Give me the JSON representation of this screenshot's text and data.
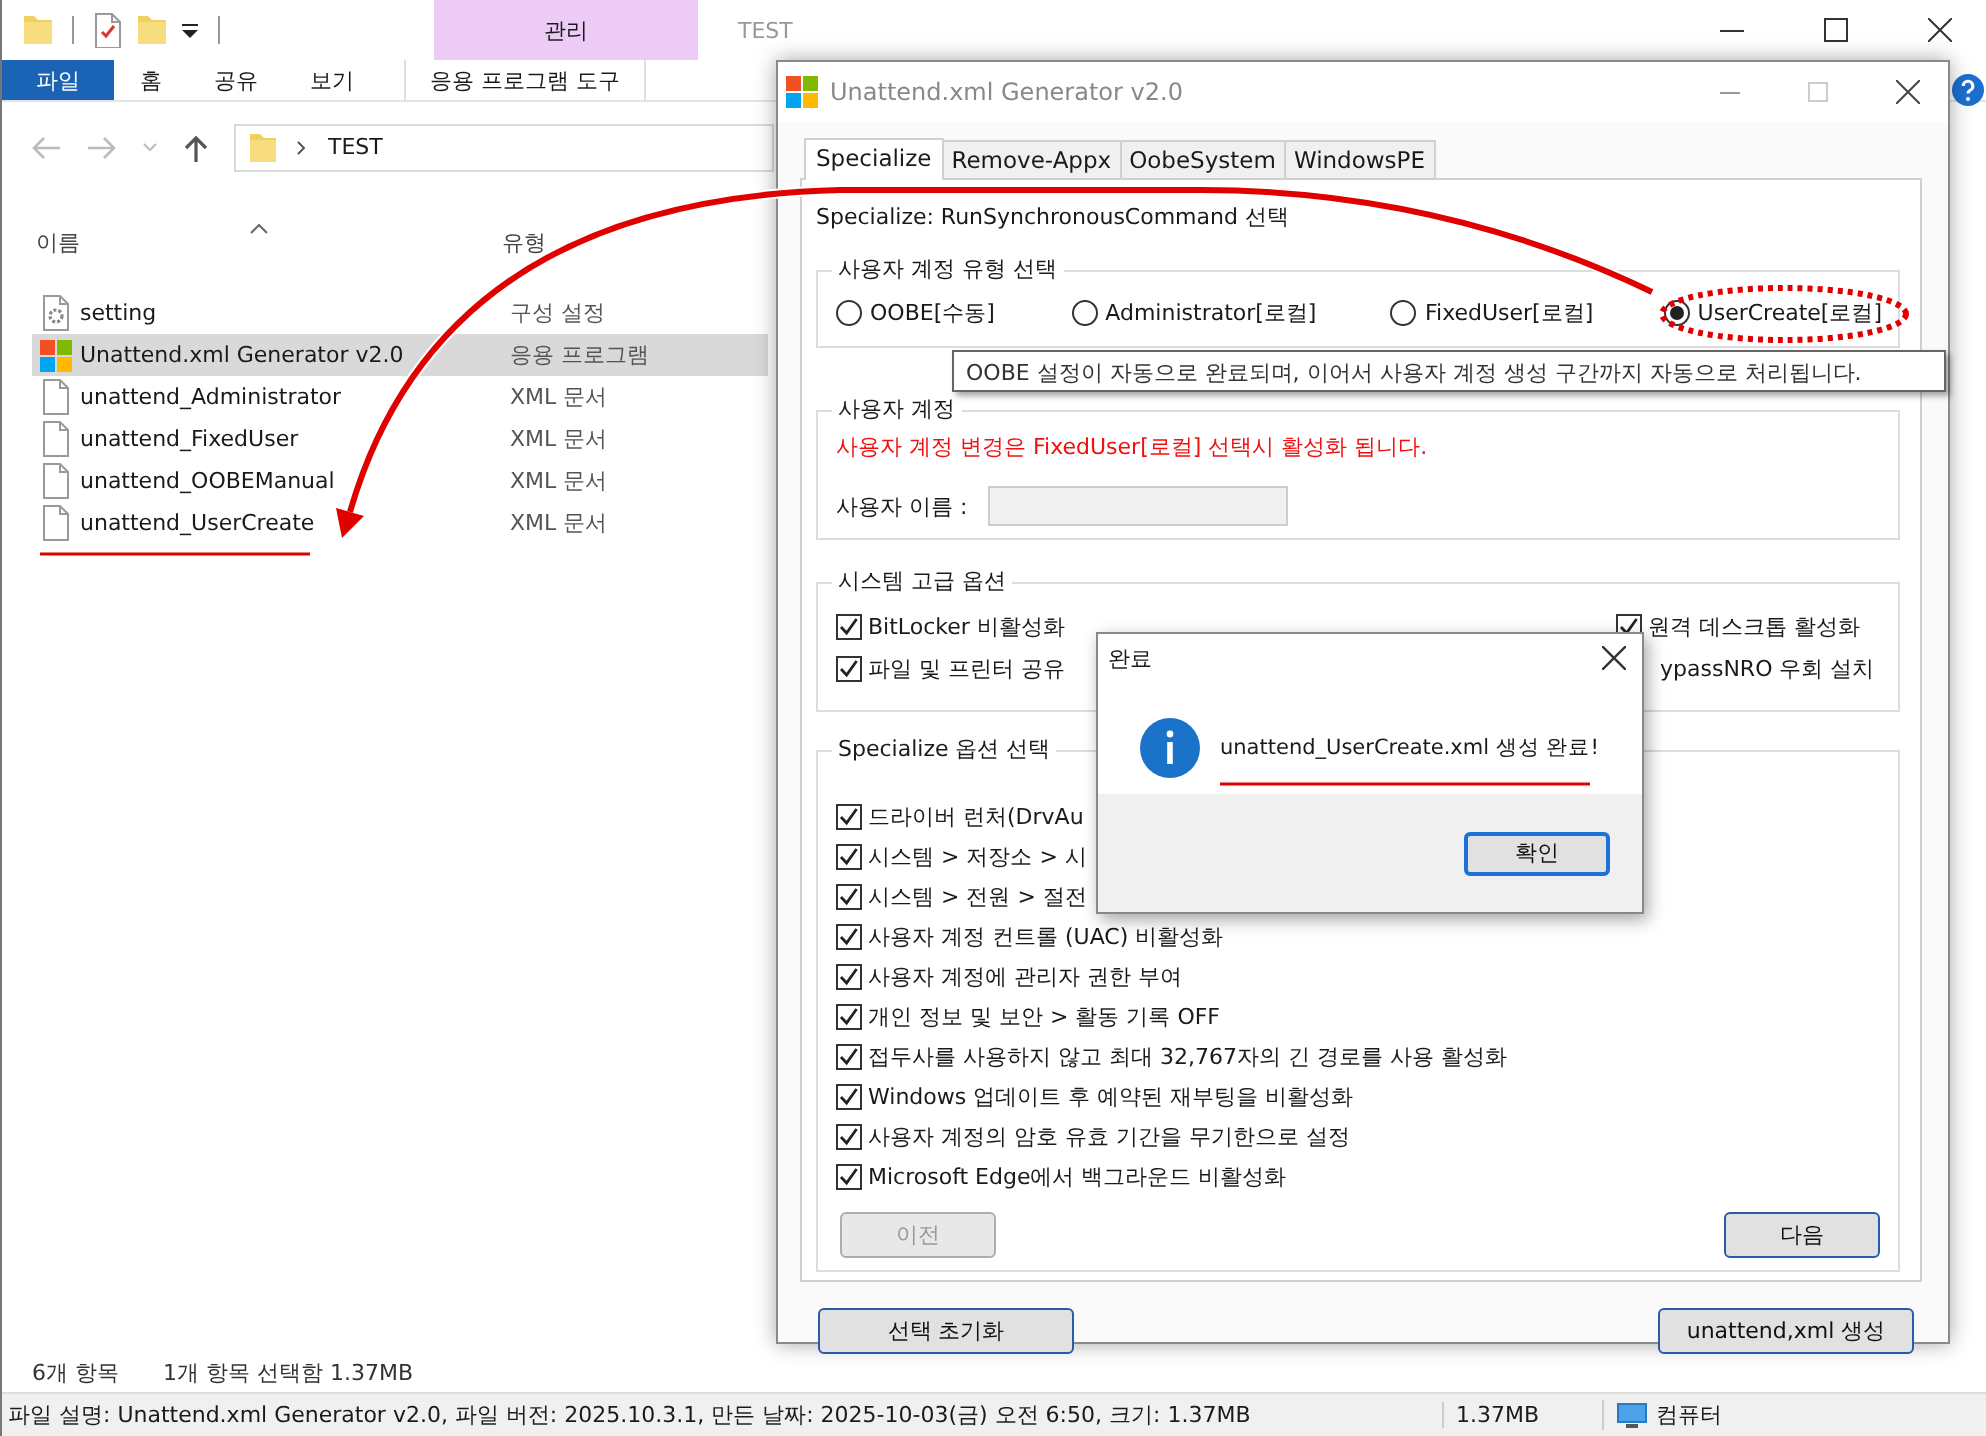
{
  "explorer": {
    "context_header": "관리",
    "title": "TEST",
    "ribbon_tabs": [
      {
        "label": "파일",
        "kind": "file"
      },
      {
        "label": "홈",
        "kind": "tab"
      },
      {
        "label": "공유",
        "kind": "tab"
      },
      {
        "label": "보기",
        "kind": "tab"
      },
      {
        "label": "응용 프로그램 도구",
        "kind": "context"
      }
    ],
    "address": {
      "path": "TEST"
    },
    "columns": [
      "이름",
      "유형"
    ],
    "files": [
      {
        "name": "setting",
        "type": "구성 설정",
        "kind": "settings",
        "selected": false
      },
      {
        "name": "Unattend.xml Generator v2.0",
        "type": "응용 프로그램",
        "kind": "app",
        "selected": true
      },
      {
        "name": "unattend_Administrator",
        "type": "XML 문서",
        "kind": "doc",
        "selected": false
      },
      {
        "name": "unattend_FixedUser",
        "type": "XML 문서",
        "kind": "doc",
        "selected": false
      },
      {
        "name": "unattend_OOBEManual",
        "type": "XML 문서",
        "kind": "doc",
        "selected": false
      },
      {
        "name": "unattend_UserCreate",
        "type": "XML 문서",
        "kind": "doc",
        "selected": false
      }
    ],
    "status": [
      "6개 항목",
      "1개 항목 선택함 1.37MB"
    ],
    "details": {
      "description": "파일 설명: Unattend.xml Generator v2.0, 파일 버전: 2025.10.3.1, 만든 날짜: 2025-10-03(금) 오전 6:50, 크기: 1.37MB",
      "size": "1.37MB",
      "location": "컴퓨터"
    }
  },
  "dialog": {
    "title": "Unattend.xml Generator v2.0",
    "tabs": [
      {
        "label": "Specialize",
        "selected": true
      },
      {
        "label": "Remove-Appx",
        "selected": false
      },
      {
        "label": "OobeSystem",
        "selected": false
      },
      {
        "label": "WindowsPE",
        "selected": false
      }
    ],
    "heading": "Specialize: RunSynchronousCommand 선택",
    "account_type": {
      "legend": "사용자 계정 유형 선택",
      "options": [
        {
          "label": "OOBE[수동]",
          "selected": false
        },
        {
          "label": "Administrator[로컬]",
          "selected": false
        },
        {
          "label": "FixedUser[로컬]",
          "selected": false
        },
        {
          "label": "UserCreate[로컬]",
          "selected": true
        }
      ]
    },
    "account_change": {
      "legend": "사용자 계정",
      "notice": "사용자 계정 변경은 FixedUser[로컬] 선택시 활성화 됩니다.",
      "field_label": "사용자 이름 :",
      "field_disabled": true
    },
    "advanced": {
      "legend": "시스템 고급 옵션",
      "options": [
        {
          "label": "BitLocker 비활성화",
          "checked": true
        },
        {
          "label": "원격 데스크톱 활성화",
          "checked": true
        },
        {
          "label": "파일 및 프린터 공유",
          "checked": true
        },
        {
          "label": "ypassNRO 우회 설치"
        }
      ]
    },
    "specialize": {
      "legend": "Specialize 옵션 선택",
      "options": [
        {
          "label": "드라이버 런처(DrvAu",
          "checked": true
        },
        {
          "label": "시스템 > 저장소 > 시",
          "checked": true
        },
        {
          "label": "시스템 > 전원 > 절전",
          "checked": true
        },
        {
          "label": "사용자 계정 컨트롤 (UAC) 비활성화",
          "checked": true
        },
        {
          "label": "사용자 계정에 관리자 권한 부여",
          "checked": true
        },
        {
          "label": "개인 정보 및 보안 > 활동 기록 OFF",
          "checked": true
        },
        {
          "label": "접두사를 사용하지 않고 최대 32,767자의 긴 경로를 사용 활성화",
          "checked": true
        },
        {
          "label": "Windows 업데이트 후 예약된 재부팅을 비활성화",
          "checked": true
        },
        {
          "label": "사용자 계정의 암호 유효 기간을 무기한으로 설정",
          "checked": true
        },
        {
          "label": "Microsoft Edge에서 백그라운드 비활성화",
          "checked": true
        }
      ]
    },
    "nav_buttons": [
      {
        "label": "이전",
        "disabled": true
      },
      {
        "label": "다음",
        "disabled": false
      }
    ],
    "footer_buttons": [
      "선택 초기화",
      "unattend,xml 생성"
    ]
  },
  "tooltip": "OOBE 설정이 자동으로 완료되며, 이어서 사용자 계정 생성 구간까지 자동으로 처리됩니다.",
  "message_box": {
    "title": "완료",
    "message": "unattend_UserCreate.xml 생성 완료!",
    "button": "확인"
  }
}
